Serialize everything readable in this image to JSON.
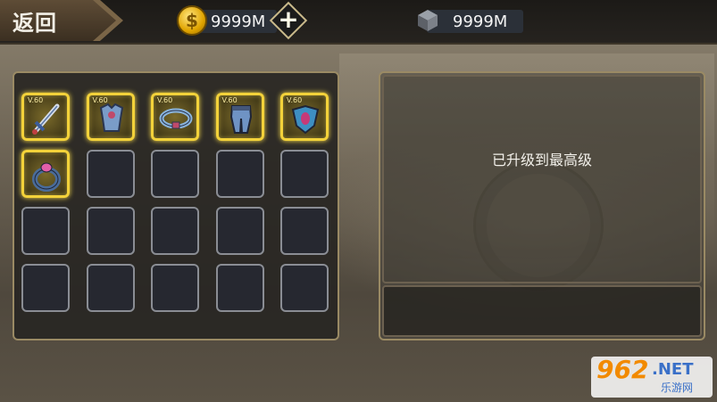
{
  "header": {
    "back_label": "返回",
    "coins": {
      "icon": "gold-coin-icon",
      "symbol": "$",
      "value": "9999M"
    },
    "add_icon": "plus-icon",
    "gems": {
      "icon": "ore-cube-icon",
      "value": "9999M"
    }
  },
  "inventory": {
    "rows": 4,
    "cols": 5,
    "items": [
      {
        "name": "sword",
        "level": "V.60",
        "icon": "sword-icon"
      },
      {
        "name": "chest-armor",
        "level": "V.60",
        "icon": "armor-icon"
      },
      {
        "name": "belt",
        "level": "V.60",
        "icon": "belt-icon"
      },
      {
        "name": "leg-armor",
        "level": "V.60",
        "icon": "leggings-icon"
      },
      {
        "name": "amulet",
        "level": "V.60",
        "icon": "amulet-icon"
      },
      {
        "name": "ring",
        "level": "",
        "icon": "ring-icon"
      }
    ]
  },
  "detail": {
    "status": "已升级到最高级"
  },
  "watermark": {
    "big": "962",
    "net": ".NET",
    "cn": "乐游网"
  },
  "colors": {
    "highlight": "#f3d23a",
    "slot_border": "#8a8d94",
    "panel_border": "#9a8a64"
  }
}
